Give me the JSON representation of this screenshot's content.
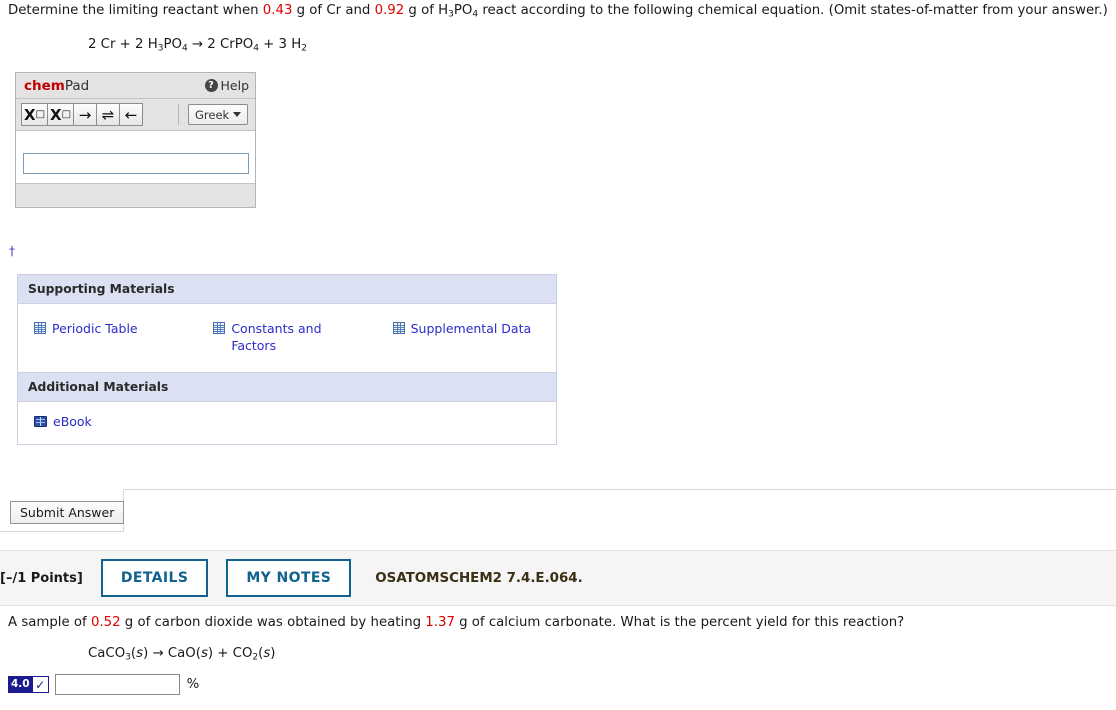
{
  "question1": {
    "prompt_parts": [
      {
        "t": "Determine the limiting reactant when ",
        "c": "black"
      },
      {
        "t": "0.43",
        "c": "red"
      },
      {
        "t": " g of Cr and ",
        "c": "black"
      },
      {
        "t": "0.92",
        "c": "red"
      },
      {
        "t": " g of H",
        "c": "black"
      },
      {
        "t": "3",
        "c": "sub"
      },
      {
        "t": "PO",
        "c": "black"
      },
      {
        "t": "4",
        "c": "sub"
      },
      {
        "t": " react according to the following chemical equation. (Omit states-of-matter from your answer.)",
        "c": "black"
      }
    ],
    "equation_parts": [
      {
        "t": "2 Cr + 2 H",
        "c": "black"
      },
      {
        "t": "3",
        "c": "sub"
      },
      {
        "t": "PO",
        "c": "black"
      },
      {
        "t": "4",
        "c": "sub"
      },
      {
        "t": " → 2 CrPO",
        "c": "black"
      },
      {
        "t": "4",
        "c": "sub"
      },
      {
        "t": " + 3 H",
        "c": "black"
      },
      {
        "t": "2",
        "c": "sub"
      }
    ],
    "footnote_marker": "†"
  },
  "chempad": {
    "title_bold": "chem",
    "title_rest": "Pad",
    "help_label": "Help",
    "help_icon": "question-mark-circle-icon",
    "toolbar_buttons": [
      {
        "name": "subscript-button",
        "glyph": "X□",
        "label": "X subscript"
      },
      {
        "name": "superscript-button",
        "glyph": "X□",
        "label": "X superscript"
      },
      {
        "name": "right-arrow-button",
        "glyph": "→",
        "label": "right arrow"
      },
      {
        "name": "equilibrium-arrow-button",
        "glyph": "⇌",
        "label": "equilibrium arrows"
      },
      {
        "name": "left-arrow-button",
        "glyph": "←",
        "label": "left arrow"
      }
    ],
    "greek_label": "Greek",
    "input_value": "",
    "input_placeholder": ""
  },
  "supporting_materials": {
    "header": "Supporting Materials",
    "links": [
      {
        "label": "Periodic Table",
        "icon": "table-grid-icon"
      },
      {
        "label": "Constants and Factors",
        "icon": "table-grid-icon"
      },
      {
        "label": "Supplemental Data",
        "icon": "table-grid-icon"
      }
    ]
  },
  "additional_materials": {
    "header": "Additional Materials",
    "links": [
      {
        "label": "eBook",
        "icon": "open-book-icon"
      }
    ]
  },
  "submit": {
    "label": "Submit Answer"
  },
  "points_bar": {
    "points_label": "[–/1 Points]",
    "details_label": "DETAILS",
    "my_notes_label": "MY NOTES",
    "assignment_code": "OSATOMSCHEM2 7.4.E.064."
  },
  "question2": {
    "prompt_parts": [
      {
        "t": "A sample of ",
        "c": "black"
      },
      {
        "t": "0.52",
        "c": "red"
      },
      {
        "t": " g of carbon dioxide was obtained by heating ",
        "c": "black"
      },
      {
        "t": "1.37",
        "c": "red"
      },
      {
        "t": " g of calcium carbonate. What is the percent yield for this reaction?",
        "c": "black"
      }
    ],
    "equation_parts": [
      {
        "t": "CaCO",
        "c": "black"
      },
      {
        "t": "3",
        "c": "sub"
      },
      {
        "t": "(s) → CaO(s) + CO",
        "c": "italic-mixed"
      },
      {
        "t": "2",
        "c": "sub"
      },
      {
        "t": "(s)",
        "c": "italic-mixed"
      }
    ],
    "equation_plain": "CaCO3(s) → CaO(s) + CO2(s)",
    "score_badge_value": "4.0",
    "score_badge_check": "✓",
    "answer_value": "",
    "answer_placeholder": "",
    "unit_label": "%"
  },
  "colors": {
    "highlight_red": "#e00000",
    "link_blue": "#2b2bc8",
    "pill_blue": "#11628e",
    "panel_header": "#dbe0f2",
    "badge_navy": "#1b1b8f"
  }
}
